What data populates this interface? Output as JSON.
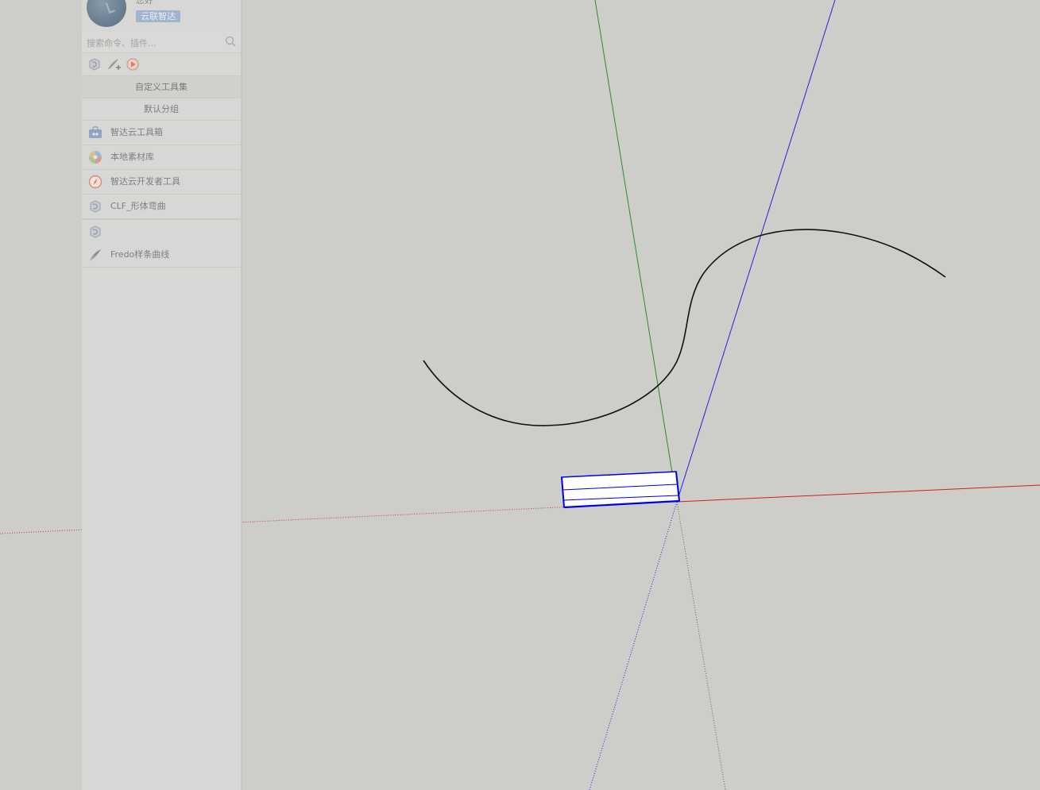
{
  "panel": {
    "username": "您好",
    "badge": "云联智达",
    "search_placeholder": "搜索命令、插件...",
    "quick_icons": [
      "plugin-icon",
      "quill-add-icon",
      "play-icon"
    ],
    "custom_toolset_label": "自定义工具集",
    "default_group_label": "默认分组",
    "tools": [
      {
        "label": "智达云工具箱",
        "icon": "toolbox-icon"
      },
      {
        "label": "本地素材库",
        "icon": "color-ball-icon"
      },
      {
        "label": "智达云开发者工具",
        "icon": "compass-icon"
      },
      {
        "label": "CLF_形体弯曲",
        "icon": "plugin-icon"
      }
    ],
    "extra_group": [
      {
        "label": "",
        "icon": "plugin-icon"
      },
      {
        "label": "Fredo样条曲线",
        "icon": "quill-icon"
      }
    ]
  },
  "viewport": {
    "axis_colors": {
      "red": "#cc0000",
      "green": "#008800",
      "blue": "#0000cc"
    },
    "curve_color": "#000000",
    "selection_color": "#0000ee"
  }
}
